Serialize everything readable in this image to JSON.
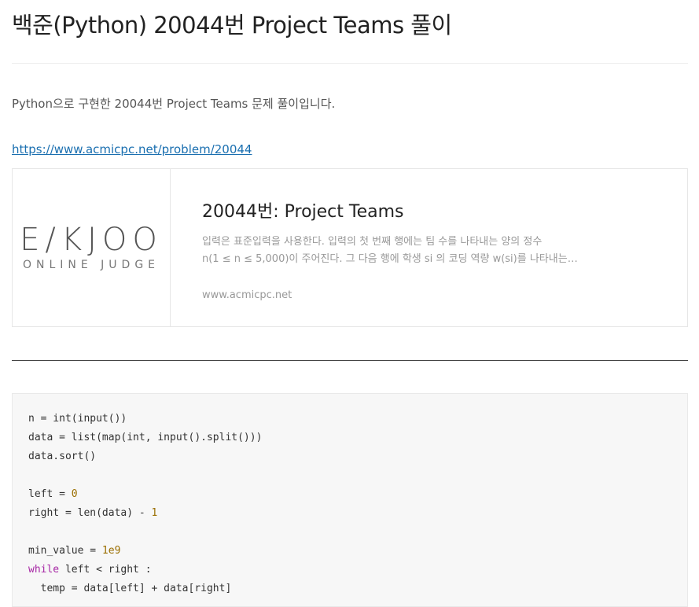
{
  "post": {
    "title": "백준(Python) 20044번 Project Teams 풀이",
    "intro": "Python으로 구현한 20044번 Project Teams 문제 풀이입니다.",
    "link": "https://www.acmicpc.net/problem/20044"
  },
  "card": {
    "logo_main": "E/KJOO",
    "logo_sub": "ONLINE JUDGE",
    "title": "20044번: Project Teams",
    "desc_line1": "입력은 표준입력을 사용한다. 입력의 첫 번째 행에는 팀 수를 나타내는 양의 정수",
    "desc_line2": "n(1 ≤ n ≤ 5,000)이 주어진다. 그 다음 행에 학생 si 의 코딩 역량 w(si)를 나타내는 …",
    "host": "www.acmicpc.net"
  },
  "code": {
    "lines": [
      "n = int(input())",
      "data = list(map(int, input().split()))",
      "data.sort()",
      "",
      "left = 0",
      "right = len(data) - 1",
      "",
      "min_value = 1e9",
      "while left < right :",
      "  temp = data[left] + data[right]"
    ]
  }
}
